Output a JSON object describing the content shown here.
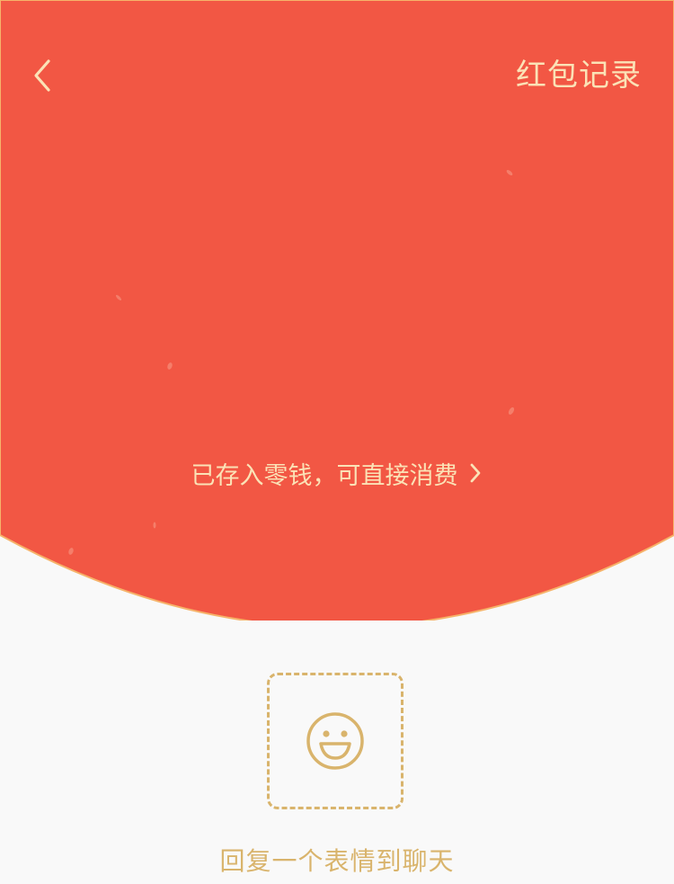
{
  "colors": {
    "red_background": "#F25744",
    "gold_text": "#FBE2B6",
    "gold_outline": "#D9B46C",
    "page_background": "#F9F9F9"
  },
  "header": {
    "back_icon": "chevron-left-icon",
    "records_label": "红包记录"
  },
  "notice": {
    "text": "已存入零钱，可直接消费",
    "arrow_icon": "chevron-right-icon"
  },
  "reply": {
    "icon": "smiley-face-icon",
    "label": "回复一个表情到聊天"
  }
}
